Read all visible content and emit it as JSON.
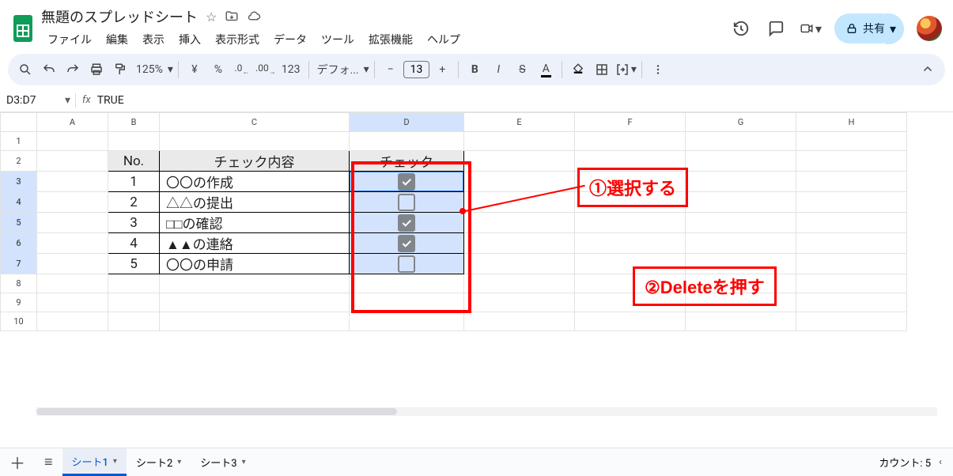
{
  "doc": {
    "title": "無題のスプレッドシート"
  },
  "menu": {
    "file": "ファイル",
    "edit": "編集",
    "view": "表示",
    "insert": "挿入",
    "format": "表示形式",
    "data": "データ",
    "tools": "ツール",
    "extensions": "拡張機能",
    "help": "ヘルプ"
  },
  "toolbar": {
    "zoom": "125%",
    "currency": "¥",
    "percent": "%",
    "dec_dec": ".0",
    "dec_inc": ".00",
    "numfmt": "123",
    "font": "デフォ...",
    "minus": "−",
    "fontsize": "13",
    "plus": "+"
  },
  "share": {
    "label": "共有"
  },
  "namebox": {
    "ref": "D3:D7",
    "formula": "TRUE"
  },
  "columns": [
    "A",
    "B",
    "C",
    "D",
    "E",
    "F",
    "G",
    "H"
  ],
  "table": {
    "headers": {
      "no": "No.",
      "content": "チェック内容",
      "check": "チェック"
    },
    "rows": [
      {
        "no": "1",
        "content": "〇〇の作成",
        "checked": true
      },
      {
        "no": "2",
        "content": "△△の提出",
        "checked": false
      },
      {
        "no": "3",
        "content": "□□の確認",
        "checked": true
      },
      {
        "no": "4",
        "content": "▲▲の連絡",
        "checked": true
      },
      {
        "no": "5",
        "content": "〇〇の申請",
        "checked": false
      }
    ]
  },
  "annotations": {
    "a1": "①選択する",
    "a2": "②Deleteを押す"
  },
  "tabs": {
    "add": "+",
    "all": "≡",
    "t1": "シート1",
    "t2": "シート2",
    "t3": "シート3"
  },
  "status": {
    "count": "カウント: 5"
  }
}
